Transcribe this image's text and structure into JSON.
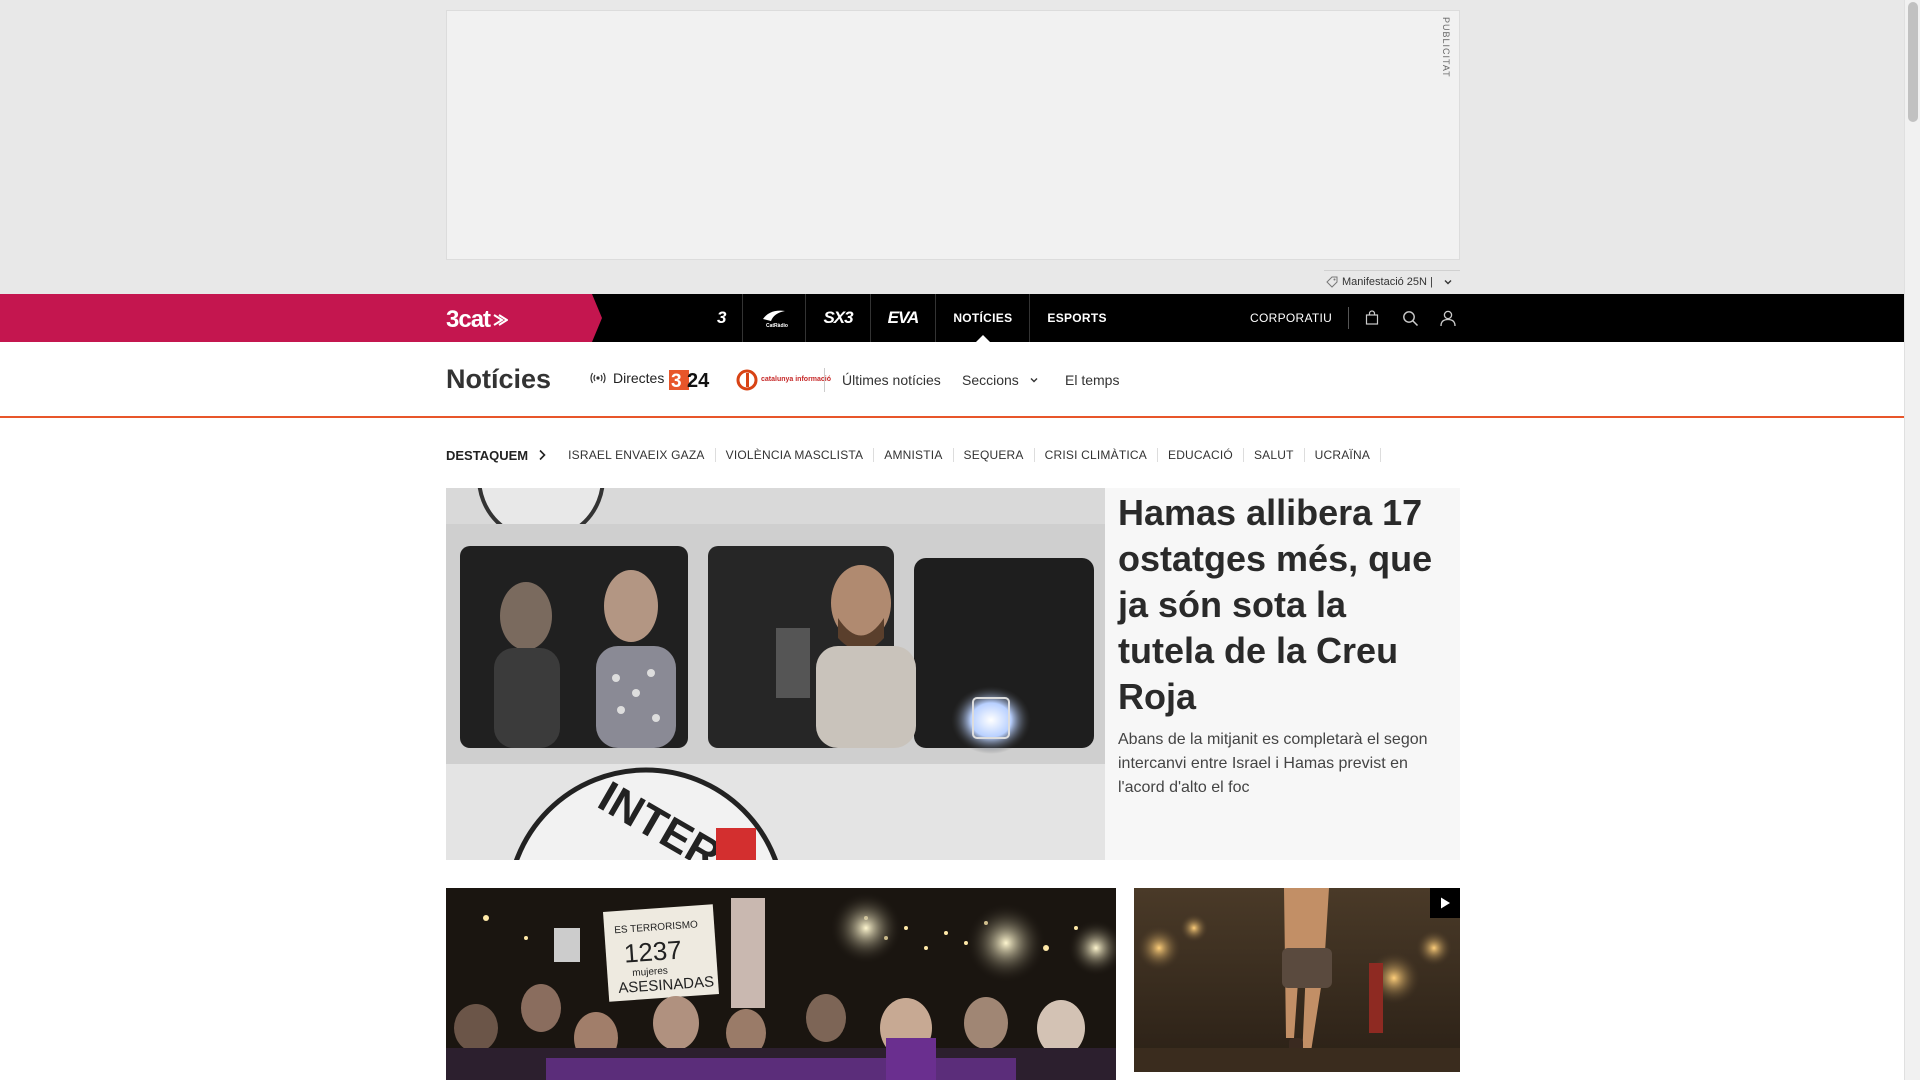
{
  "ad": {
    "label": "PUBLICITAT"
  },
  "tag_bar": {
    "text": "Manifestació 25N |"
  },
  "topnav": {
    "brand": "3cat",
    "channels": [
      {
        "label": "3",
        "type": "logo"
      },
      {
        "label": "CatRàdio",
        "type": "logo"
      },
      {
        "label": "SX3",
        "type": "logo"
      },
      {
        "label": "EVA",
        "type": "logo"
      },
      {
        "label": "NOTÍCIES",
        "type": "text"
      },
      {
        "label": "ESPORTS",
        "type": "text"
      }
    ],
    "corporate": "CORPORATIU"
  },
  "section": {
    "title": "Notícies",
    "live": "Directes",
    "logo_324": "324",
    "logo_cat": "catalunya informació",
    "links": {
      "latest": "Últimes notícies",
      "sections": "Seccions",
      "weather": "El temps"
    }
  },
  "highlights": {
    "title": "DESTAQUEM",
    "items": [
      "ISRAEL ENVAEIX GAZA",
      "VIOLÈNCIA MASCLISTA",
      "AMNISTIA",
      "SEQUERA",
      "CRISI CLIMÀTICA",
      "EDUCACIÓ",
      "SALUT",
      "UCRAÏNA"
    ]
  },
  "main_story": {
    "headline": "Hamas allibera 17 ostatges més, que ja són sota la tutela de la Creu Roja",
    "lead": "Abans de la mitjanit es completarà el segon intercanvi entre Israel i Hamas previst en l'acord d'alto el foc",
    "image_sign_text": "INTERNAT"
  },
  "secondary": {
    "protest_sign": "ES TERRORISMO 1237 mujeres ASESINADAS"
  },
  "colors": {
    "brand": "#c4164f",
    "nav_bg": "#000000",
    "section_accent": "#e8562a"
  }
}
